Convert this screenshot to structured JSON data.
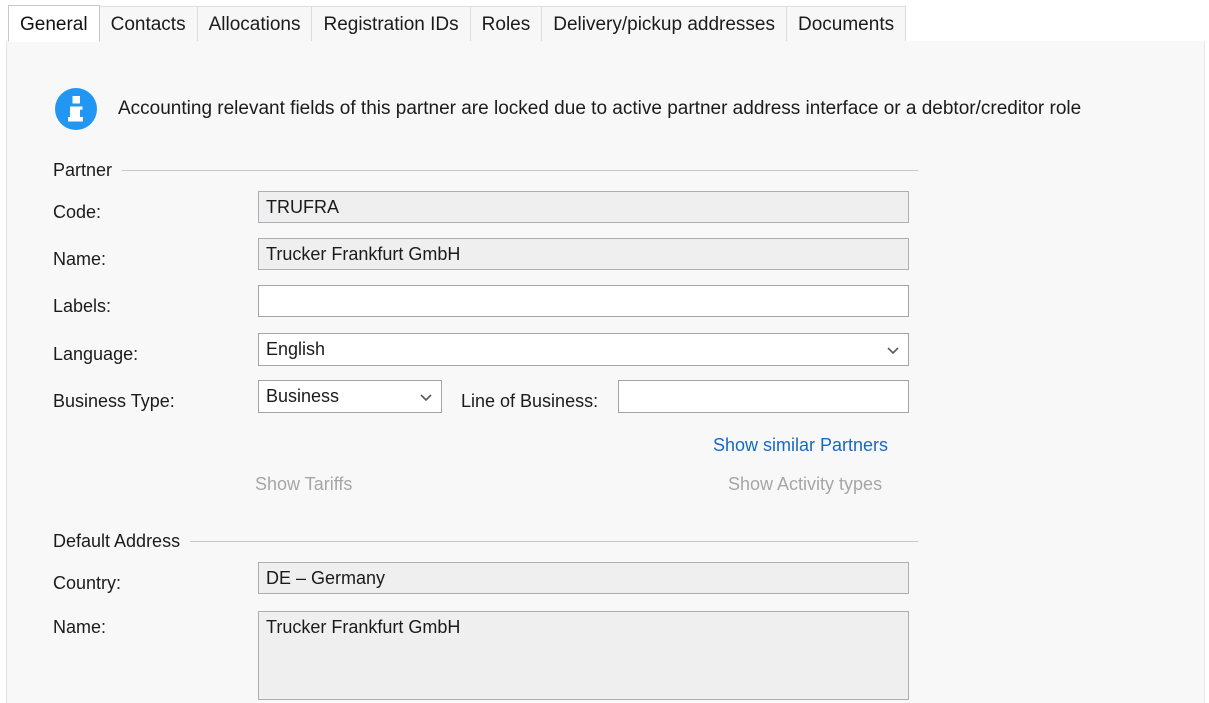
{
  "tabs": [
    {
      "label": "General",
      "active": true
    },
    {
      "label": "Contacts",
      "active": false
    },
    {
      "label": "Allocations",
      "active": false
    },
    {
      "label": "Registration IDs",
      "active": false
    },
    {
      "label": "Roles",
      "active": false
    },
    {
      "label": "Delivery/pickup addresses",
      "active": false
    },
    {
      "label": "Documents",
      "active": false
    }
  ],
  "info": {
    "icon": "info-circle-icon",
    "message": "Accounting relevant fields of this partner are locked due to active partner address interface or a debtor/creditor role",
    "icon_color": "#2196f3"
  },
  "partner": {
    "group_title": "Partner",
    "code": {
      "label": "Code:",
      "value": "TRUFRA",
      "placeholder": ""
    },
    "name": {
      "label": "Name:",
      "value": "Trucker Frankfurt GmbH",
      "placeholder": ""
    },
    "labels": {
      "label": "Labels:",
      "value": "",
      "placeholder": ""
    },
    "language": {
      "label": "Language:",
      "value": "English",
      "icon": "chevron-down-icon"
    },
    "business_type": {
      "label": "Business Type:",
      "value": "Business",
      "icon": "chevron-down-icon"
    },
    "line_of_business": {
      "label": "Line of Business:",
      "value": "",
      "placeholder": ""
    }
  },
  "links": {
    "show_similar_partners": "Show similar Partners",
    "show_tariffs": "Show Tariffs",
    "show_activity_types": "Show Activity types",
    "link_color": "#1569c7",
    "disabled_color": "#a6a6a6"
  },
  "default_address": {
    "group_title": "Default Address",
    "country": {
      "label": "Country:",
      "value": "DE – Germany"
    },
    "name": {
      "label": "Name:",
      "value": "Trucker Frankfurt GmbH"
    }
  }
}
